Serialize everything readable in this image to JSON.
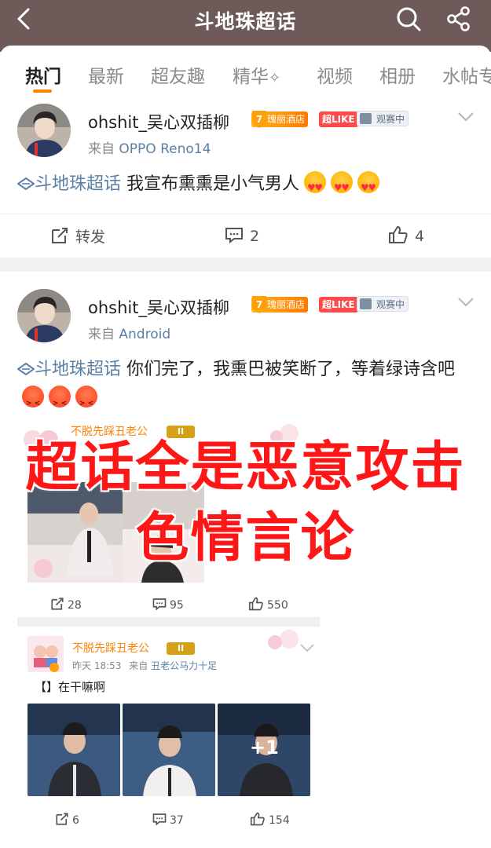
{
  "header": {
    "title": "斗地珠超话"
  },
  "tabs": [
    {
      "label": "热门"
    },
    {
      "label": "最新"
    },
    {
      "label": "超友趣"
    },
    {
      "label": "精华"
    },
    {
      "label": "视频"
    },
    {
      "label": "相册"
    },
    {
      "label": "水帖专"
    }
  ],
  "posts": [
    {
      "username": "ohshit_吴心双插柳",
      "badge_level": "7",
      "badge_hotel": "瑰丽酒店",
      "badge_like": "超LIKE",
      "badge_watch": "观赛中",
      "source_prefix": "来自",
      "source": "OPPO Reno14",
      "topic": "斗地珠超话",
      "text": "我宣布熏熏是小气男人",
      "repost_label": "转发",
      "comments": "2",
      "likes": "4"
    },
    {
      "username": "ohshit_吴心双插柳",
      "badge_level": "7",
      "badge_hotel": "瑰丽酒店",
      "badge_like": "超LIKE",
      "badge_watch": "观赛中",
      "source_prefix": "来自",
      "source": "Android",
      "topic": "斗地珠超话",
      "text": "你们完了，我熏巴被笑断了，等着绿诗含吧"
    }
  ],
  "embed": {
    "card1": {
      "username": "不脱先踩丑老公",
      "crown": "II",
      "reposts": "28",
      "comments": "95",
      "likes": "550"
    },
    "card2": {
      "username": "不脱先踩丑老公",
      "crown": "II",
      "time": "昨天 18:53",
      "source_prefix": "来自",
      "source": "丑老公马力十足",
      "text": "【】在干嘛啊",
      "more_photos": "+1",
      "reposts": "6",
      "comments": "37",
      "likes": "154"
    }
  },
  "overlay": {
    "line1": "超话全是恶意攻击",
    "line2": "色情言论"
  },
  "colors": {
    "header_bg": "#6e5a58",
    "accent": "#ff8200",
    "link": "#5b7fa6",
    "overlay_text": "#ff1616"
  }
}
